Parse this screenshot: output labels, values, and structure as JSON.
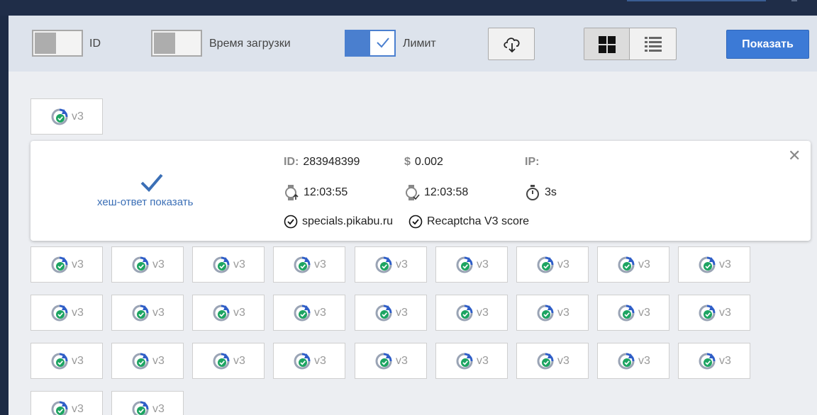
{
  "toolbar": {
    "id_label": "ID",
    "time_label": "Время загрузки",
    "limit_label": "Лимит",
    "show_button": "Показать",
    "toggles": {
      "id": false,
      "time": false,
      "limit": true
    }
  },
  "tile_label": "v3",
  "card": {
    "id_key": "ID:",
    "id_value": "283948399",
    "price_key": "$",
    "price_value": "0.002",
    "ip_key": "IP:",
    "ip_value": "",
    "time_start": "12:03:55",
    "time_end": "12:03:58",
    "duration": "3s",
    "hash_link": "хеш-ответ",
    "hash_show": "показать",
    "site": "specials.pikabu.ru",
    "type": "Recaptcha V3 score"
  },
  "colors": {
    "accent": "#3c7ad6",
    "check": "#3b6fb6",
    "recaptcha_green": "#1da462"
  }
}
